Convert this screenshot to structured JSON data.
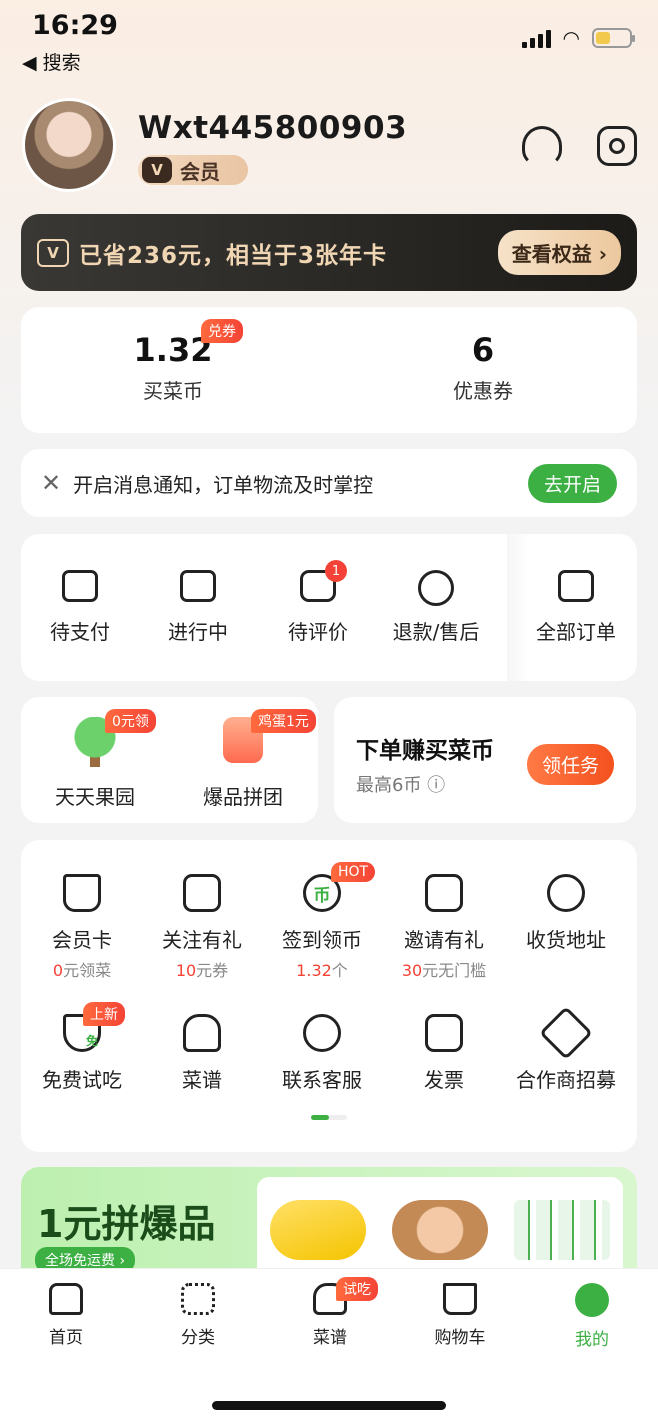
{
  "status": {
    "time": "16:29",
    "back": "◀ 搜索"
  },
  "profile": {
    "username": "Wxt445800903",
    "member_label": "会员"
  },
  "savings": {
    "text": "已省236元，相当于3张年卡",
    "button": "查看权益 ›"
  },
  "stats": {
    "coins": {
      "value": "1.32",
      "label": "买菜币",
      "badge": "兑券"
    },
    "coupons": {
      "value": "6",
      "label": "优惠券"
    }
  },
  "notice": {
    "text": "开启消息通知，订单物流及时掌控",
    "button": "去开启"
  },
  "orders": [
    {
      "label": "待支付"
    },
    {
      "label": "进行中"
    },
    {
      "label": "待评价",
      "badge": "1"
    },
    {
      "label": "退款/售后"
    },
    {
      "label": "全部订单"
    }
  ],
  "promos": {
    "garden": {
      "label": "天天果园",
      "tag": "0元领"
    },
    "group": {
      "label": "爆品拼团",
      "tag": "鸡蛋1元"
    },
    "earn": {
      "title": "下单赚买菜币",
      "subtitle": "最高6币 ⓘ",
      "button": "领任务"
    }
  },
  "services": [
    {
      "label": "会员卡",
      "sub_red": "0",
      "sub": "元领菜"
    },
    {
      "label": "关注有礼",
      "sub_red": "10",
      "sub": "元券"
    },
    {
      "label": "签到领币",
      "sub_red": "1.32",
      "sub": "个",
      "tag": "HOT",
      "icon_text": "币"
    },
    {
      "label": "邀请有礼",
      "sub_red": "30",
      "sub": "元无门槛"
    },
    {
      "label": "收货地址"
    },
    {
      "label": "免费试吃",
      "tag": "上新",
      "icon_text": "免"
    },
    {
      "label": "菜谱"
    },
    {
      "label": "联系客服"
    },
    {
      "label": "发票"
    },
    {
      "label": "合作商招募"
    }
  ],
  "banner": {
    "title": "1元拼爆品",
    "subtitle": "全场免运费 ›"
  },
  "tabs": [
    {
      "label": "首页"
    },
    {
      "label": "分类"
    },
    {
      "label": "菜谱",
      "tag": "试吃"
    },
    {
      "label": "购物车"
    },
    {
      "label": "我的"
    }
  ],
  "colors": {
    "accent": "#3cb043",
    "badge": "#f44336",
    "gold": "#f1d6b4"
  }
}
